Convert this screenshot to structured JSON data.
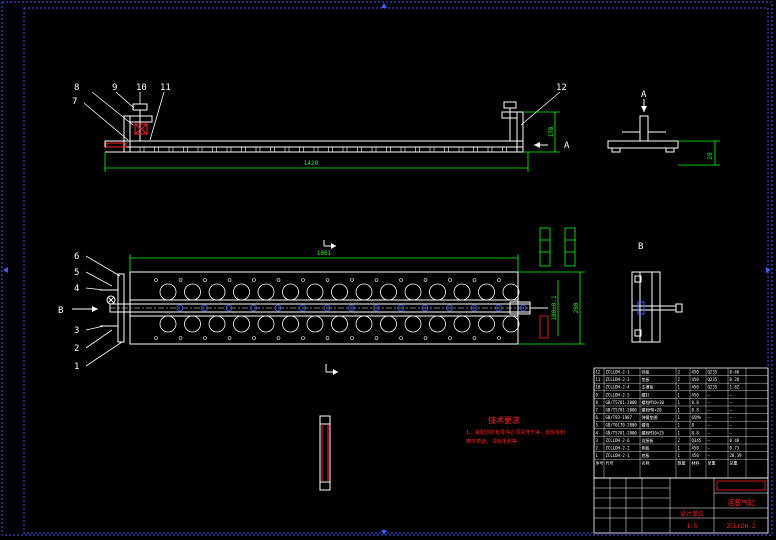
{
  "drawing": {
    "background": "#000000",
    "colors": {
      "outline": "#ffffff",
      "dimension": "#00ff00",
      "border": "#3d5cff",
      "text": "#ff2020",
      "table": "#ffffff",
      "accent": "#ff2020",
      "hatch": "#ff2020"
    }
  },
  "callouts": {
    "front_view": [
      "8",
      "9",
      "10",
      "11",
      "7",
      "12"
    ],
    "plan_view": [
      "6",
      "5",
      "4",
      "3",
      "2",
      "1"
    ]
  },
  "dimensions": {
    "front_length": "1420",
    "front_height": "178",
    "side_height": "29",
    "plan_length": "1861",
    "plan_width": "260",
    "plan_inner": "180±0.1"
  },
  "view_labels": {
    "a_arrow": "A",
    "a_view": "A",
    "b_arrow": "B",
    "b_view": "B"
  },
  "notes": {
    "title": "技术要求",
    "lines": [
      "1. 装配前所有零件必须清洗干净，去除毛刺",
      "铸件表面, 清除毛刺等"
    ]
  },
  "bom": {
    "rows": [
      [
        "12",
        "ZCLLDH-2-1",
        "挡板",
        "2",
        "450",
        "Q235",
        "0.46"
      ],
      [
        "11",
        "ZCLLDH-2-3",
        "垫板",
        "2",
        "450",
        "Q235",
        "0.28"
      ],
      [
        "10",
        "ZCLLDH-2-4",
        "支撑板",
        "1",
        "450",
        "Q235",
        "1.82"
      ],
      [
        "9",
        "ZCLLDH-2-5",
        "螺钉",
        "1",
        "450",
        "—",
        "—"
      ],
      [
        "8",
        "GB/T5781-2000",
        "螺栓M10×30",
        "1",
        "8.8",
        "—",
        "—"
      ],
      [
        "7",
        "GB/T5781-2000",
        "螺栓M8×20",
        "1",
        "8.8",
        "—",
        "—"
      ],
      [
        "6",
        "GB/T93-1987",
        "弹簧垫圈",
        "1",
        "65Mn",
        "—",
        "—"
      ],
      [
        "5",
        "GB/T6170-2000",
        "螺母",
        "1",
        "8",
        "—",
        "—"
      ],
      [
        "4",
        "GB/T5781-2000",
        "螺栓M10×25",
        "1",
        "8.8",
        "—",
        "—"
      ],
      [
        "3",
        "ZCLLDH-2-6",
        "连接板",
        "2",
        "Q345",
        "—",
        "0.48"
      ],
      [
        "2",
        "ZCLLDH-2-2",
        "侧板",
        "1",
        "450",
        "—",
        "0.73"
      ],
      [
        "1",
        "ZCLLDH-2-1",
        "底板",
        "1",
        "450",
        "—",
        "28.39"
      ]
    ],
    "header": [
      "序号",
      "代号",
      "名称",
      "数量",
      "材料",
      "单重",
      "总重"
    ]
  },
  "title_block": {
    "name": "活塞气缸",
    "drawing_no": "ZCLLDH-2",
    "company": "设计单位",
    "scale": "1:5"
  }
}
